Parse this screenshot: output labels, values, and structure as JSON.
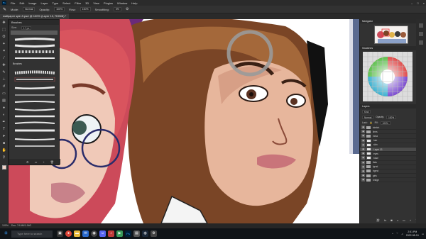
{
  "menubar": {
    "items": [
      "File",
      "Edit",
      "Image",
      "Layer",
      "Type",
      "Select",
      "Filter",
      "3D",
      "View",
      "Plugins",
      "Window",
      "Help"
    ]
  },
  "options": {
    "mode_label": "Mode:",
    "mode_value": "Normal",
    "opacity_label": "Opacity:",
    "opacity_value": "100%",
    "flow_label": "Flow:",
    "flow_value": "100%",
    "smoothing_label": "Smoothing:",
    "smoothing_value": "0%"
  },
  "document": {
    "tab_title": "wallpaper spin.9.psd @ 100% (Layer 13, RGB/8) *"
  },
  "brushes_panel": {
    "title": "Brushes",
    "size_label": "Size:",
    "size_value": "17 px",
    "folder_name": "Brushes"
  },
  "navigator": {
    "title": "Navigator"
  },
  "swatches": {
    "title": "Swatches"
  },
  "layers_panel": {
    "title": "Layers",
    "kind_label": "Kind",
    "blend_mode": "Normal",
    "opacity_label": "Opacity:",
    "opacity_value": "100%",
    "lock_label": "Lock:",
    "fill_label": "Fill:",
    "fill_value": "100%",
    "layers": [
      {
        "name": "sketch",
        "type": "folder",
        "selected": false
      },
      {
        "name": "lines",
        "type": "folder",
        "selected": false
      },
      {
        "name": "mma",
        "type": "folder",
        "selected": false
      },
      {
        "name": "hair",
        "type": "layer",
        "selected": false
      },
      {
        "name": "skin",
        "type": "layer",
        "selected": false
      },
      {
        "name": "Layer 13",
        "type": "layer",
        "selected": true
      },
      {
        "name": "eyes",
        "type": "layer",
        "selected": false
      },
      {
        "name": "base",
        "type": "layer",
        "selected": false
      },
      {
        "name": "flats",
        "type": "folder",
        "selected": false
      },
      {
        "name": "fgrnd",
        "type": "folder",
        "selected": false
      },
      {
        "name": "bgrnd",
        "type": "folder",
        "selected": false
      },
      {
        "name": "girls",
        "type": "folder",
        "selected": false
      },
      {
        "name": "bridge",
        "type": "folder",
        "selected": false
      }
    ]
  },
  "status": {
    "zoom": "100%",
    "doc_size": "Doc: 74.6M/1.94G"
  },
  "taskbar": {
    "search_placeholder": "Type here to search",
    "time": "2:51 PM",
    "date": "2022-08-24"
  },
  "colors": {
    "menubar": "#2b2b2b",
    "panel": "#323232",
    "selected_layer": "#4b4b4b",
    "taskbar": "#101418",
    "foreground_color": "#f2d3c6"
  }
}
